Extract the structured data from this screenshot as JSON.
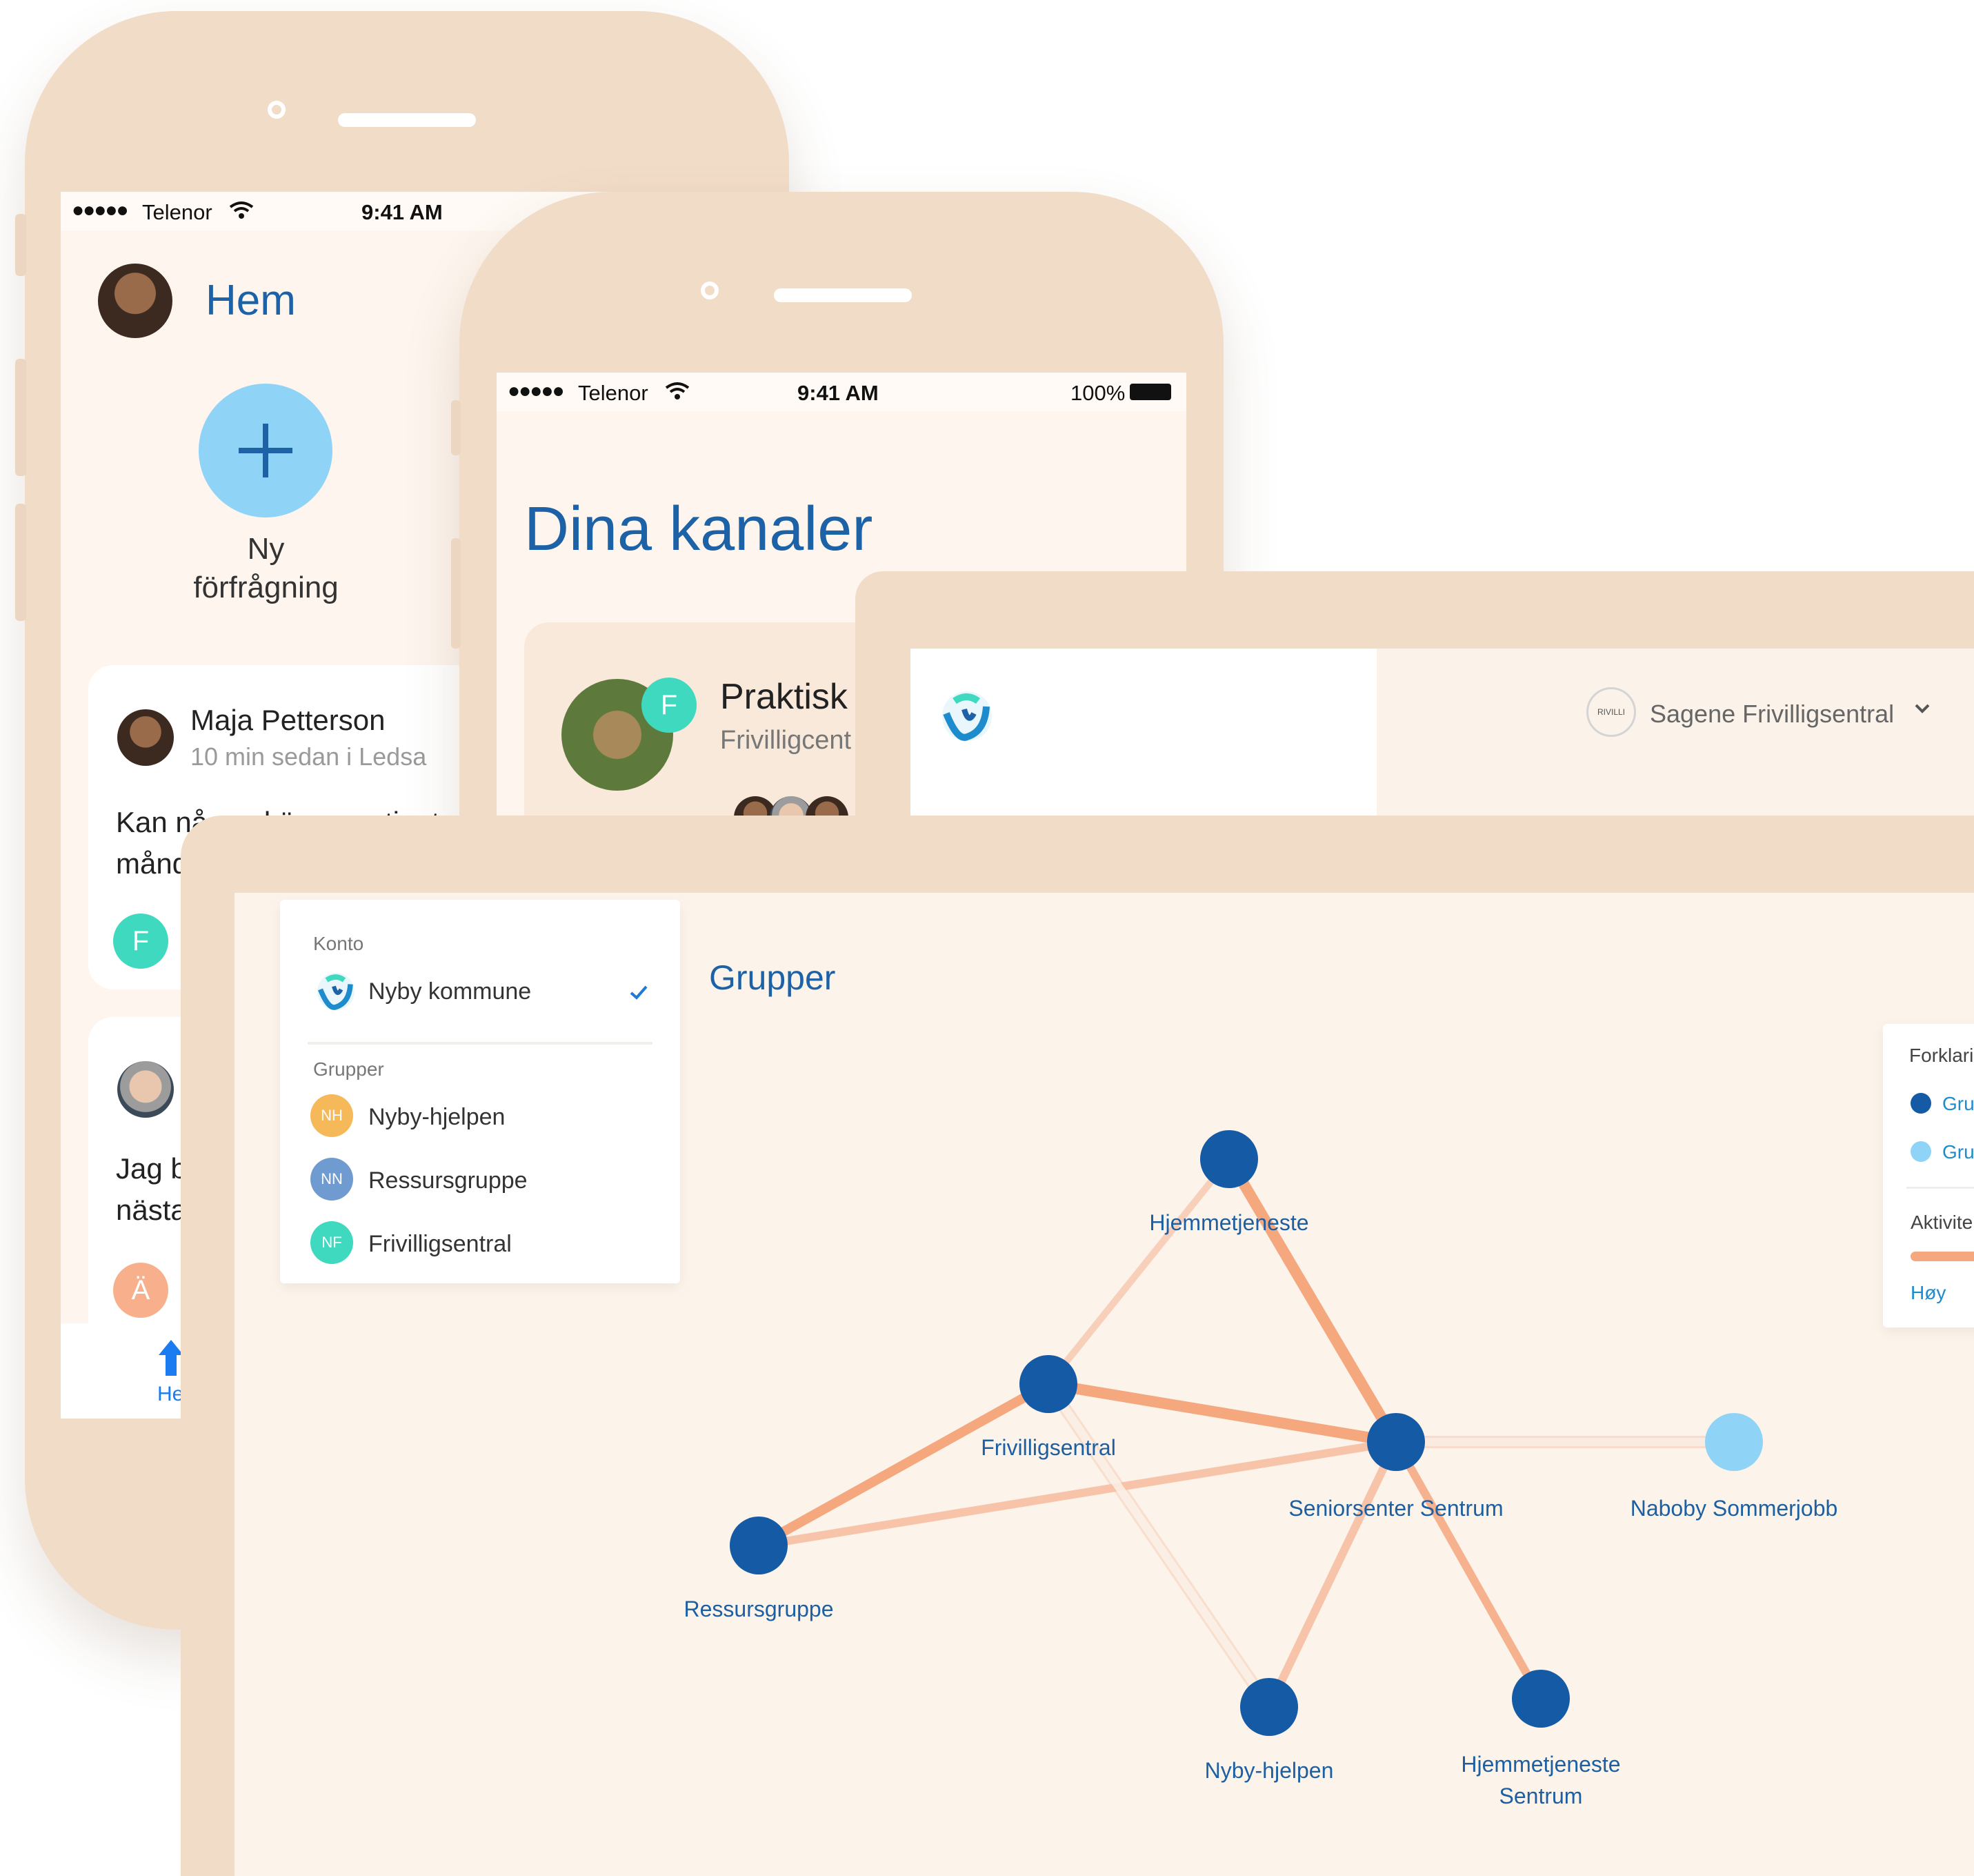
{
  "phone1": {
    "status": {
      "signal": "●●●●●",
      "carrier": "Telenor",
      "time": "9:41 AM"
    },
    "title": "Hem",
    "new_request_label_1": "Ny",
    "new_request_label_2": "förfrågning",
    "post1": {
      "author": "Maja Petterson",
      "meta": "10 min sedan i Ledsa",
      "text_line1": "Kan någon kör en patient",
      "text_line2": "månd",
      "badge": "F"
    },
    "post2": {
      "text_line1": "Jag b",
      "text_line2": "nästa",
      "badge": "Ä"
    },
    "tab_home": "He"
  },
  "phone2": {
    "status": {
      "signal": "●●●●●",
      "carrier": "Telenor",
      "time": "9:41 AM",
      "battery": "100%"
    },
    "title": "Dina kanaler",
    "channel": {
      "name": "Praktisk",
      "sub": "Frivilligcent",
      "badge": "F"
    }
  },
  "tablet_mid": {
    "org_name": "Sagene Frivilligsentral",
    "org_logo_text": "RIVILLI"
  },
  "dashboard": {
    "menu": {
      "account_header": "Konto",
      "account_name": "Nyby kommune",
      "groups_header": "Grupper",
      "groups": [
        {
          "initials": "NH",
          "name": "Nyby-hjelpen",
          "color": "#f6b95a"
        },
        {
          "initials": "NN",
          "name": "Ressursgruppe",
          "color": "#6f9bd0"
        },
        {
          "initials": "NF",
          "name": "Frivilligsentral",
          "color": "#3fd9c0"
        }
      ]
    },
    "title": "Grupper",
    "legend": {
      "header": "Forklari",
      "item1": "Gru",
      "item2": "Gru",
      "activity_header": "Aktivite",
      "activity_high": "Høy"
    },
    "nodes": {
      "hjemmetjeneste": "Hjemmetjeneste",
      "frivilligsentral": "Frivilligsentral",
      "seniorsenter": "Seniorsenter Sentrum",
      "naboby": "Naboby Sommerjobb",
      "ressursgruppe": "Ressursgruppe",
      "nyby_hjelpen": "Nyby-hjelpen",
      "hjemmetjeneste_sentrum_1": "Hjemmetjeneste",
      "hjemmetjeneste_sentrum_2": "Sentrum"
    },
    "colors": {
      "node_dark": "#145aa5",
      "node_light": "#8fd4f7",
      "edge": "#f5a77e"
    }
  }
}
